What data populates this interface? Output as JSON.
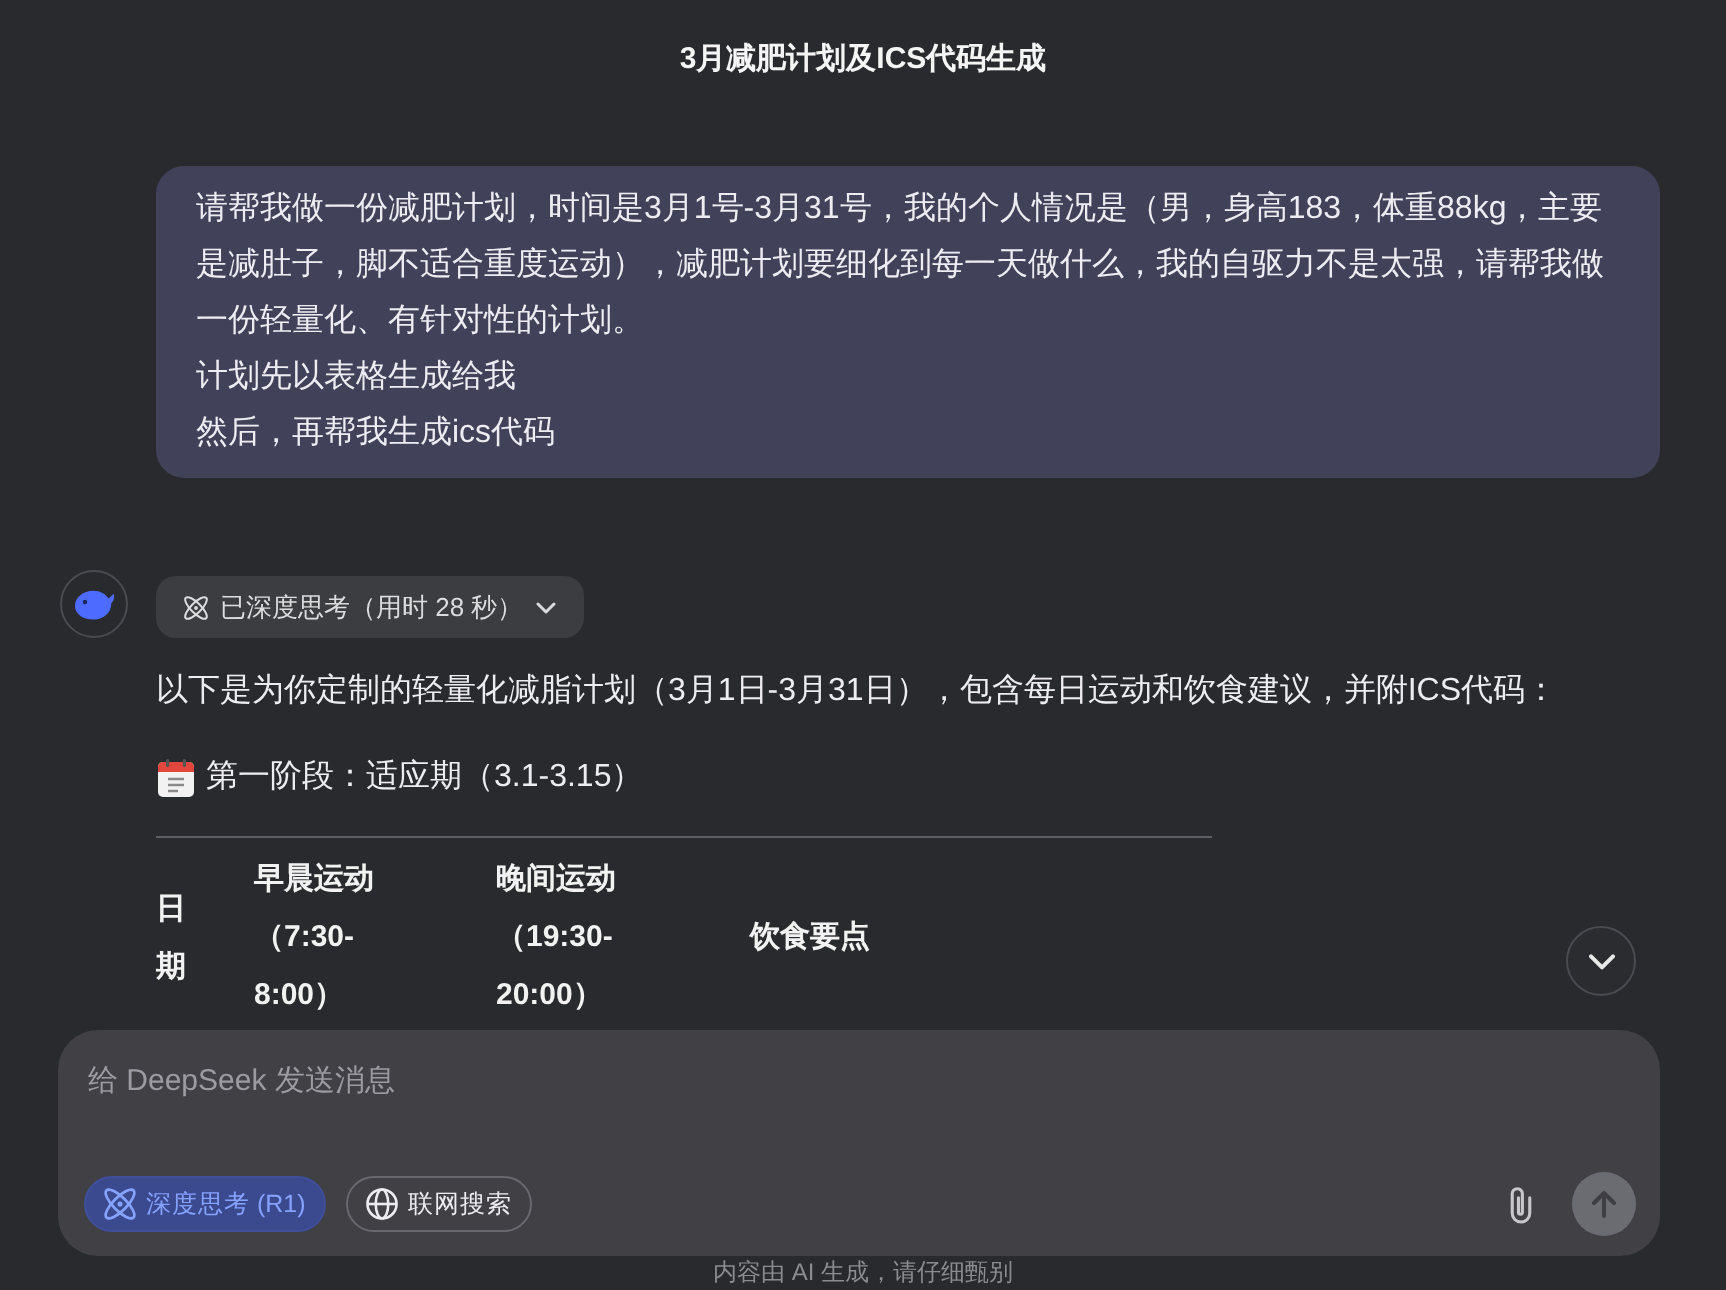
{
  "window": {
    "title": "3月减肥计划及ICS代码生成"
  },
  "user_message": {
    "paragraphs": [
      "请帮我做一份减肥计划，时间是3月1号-3月31号，我的个人情况是（男，身高183，体重88kg，主要是减肚子，脚不适合重度运动），减肥计划要细化到每一天做什么，我的自驱力不是太强，请帮我做一份轻量化、有针对性的计划。",
      "计划先以表格生成给我",
      "然后，再帮我生成ics代码"
    ]
  },
  "assistant_message": {
    "thinking": {
      "label": "已深度思考（用时 28 秒）",
      "expanded": false
    },
    "intro": "以下是为你定制的轻量化减脂计划（3月1日-3月31日），包含每日运动和饮食建议，并附ICS代码：",
    "section_heading": "第一阶段：适应期（3.1-3.15）",
    "table": {
      "columns": [
        "日期",
        "早晨运动（7:30-8:00）",
        "晚间运动（19:30-20:00）",
        "饮食要点"
      ]
    }
  },
  "composer": {
    "placeholder": "给 DeepSeek 发送消息",
    "toggles": [
      {
        "kind": "think",
        "label": "深度思考 (R1)",
        "selected": true
      },
      {
        "kind": "search",
        "label": "联网搜索",
        "selected": false
      }
    ],
    "send_button": {
      "disabled": true
    }
  },
  "footer": {
    "disclaimer": "内容由 AI 生成，请仔细甄别"
  }
}
